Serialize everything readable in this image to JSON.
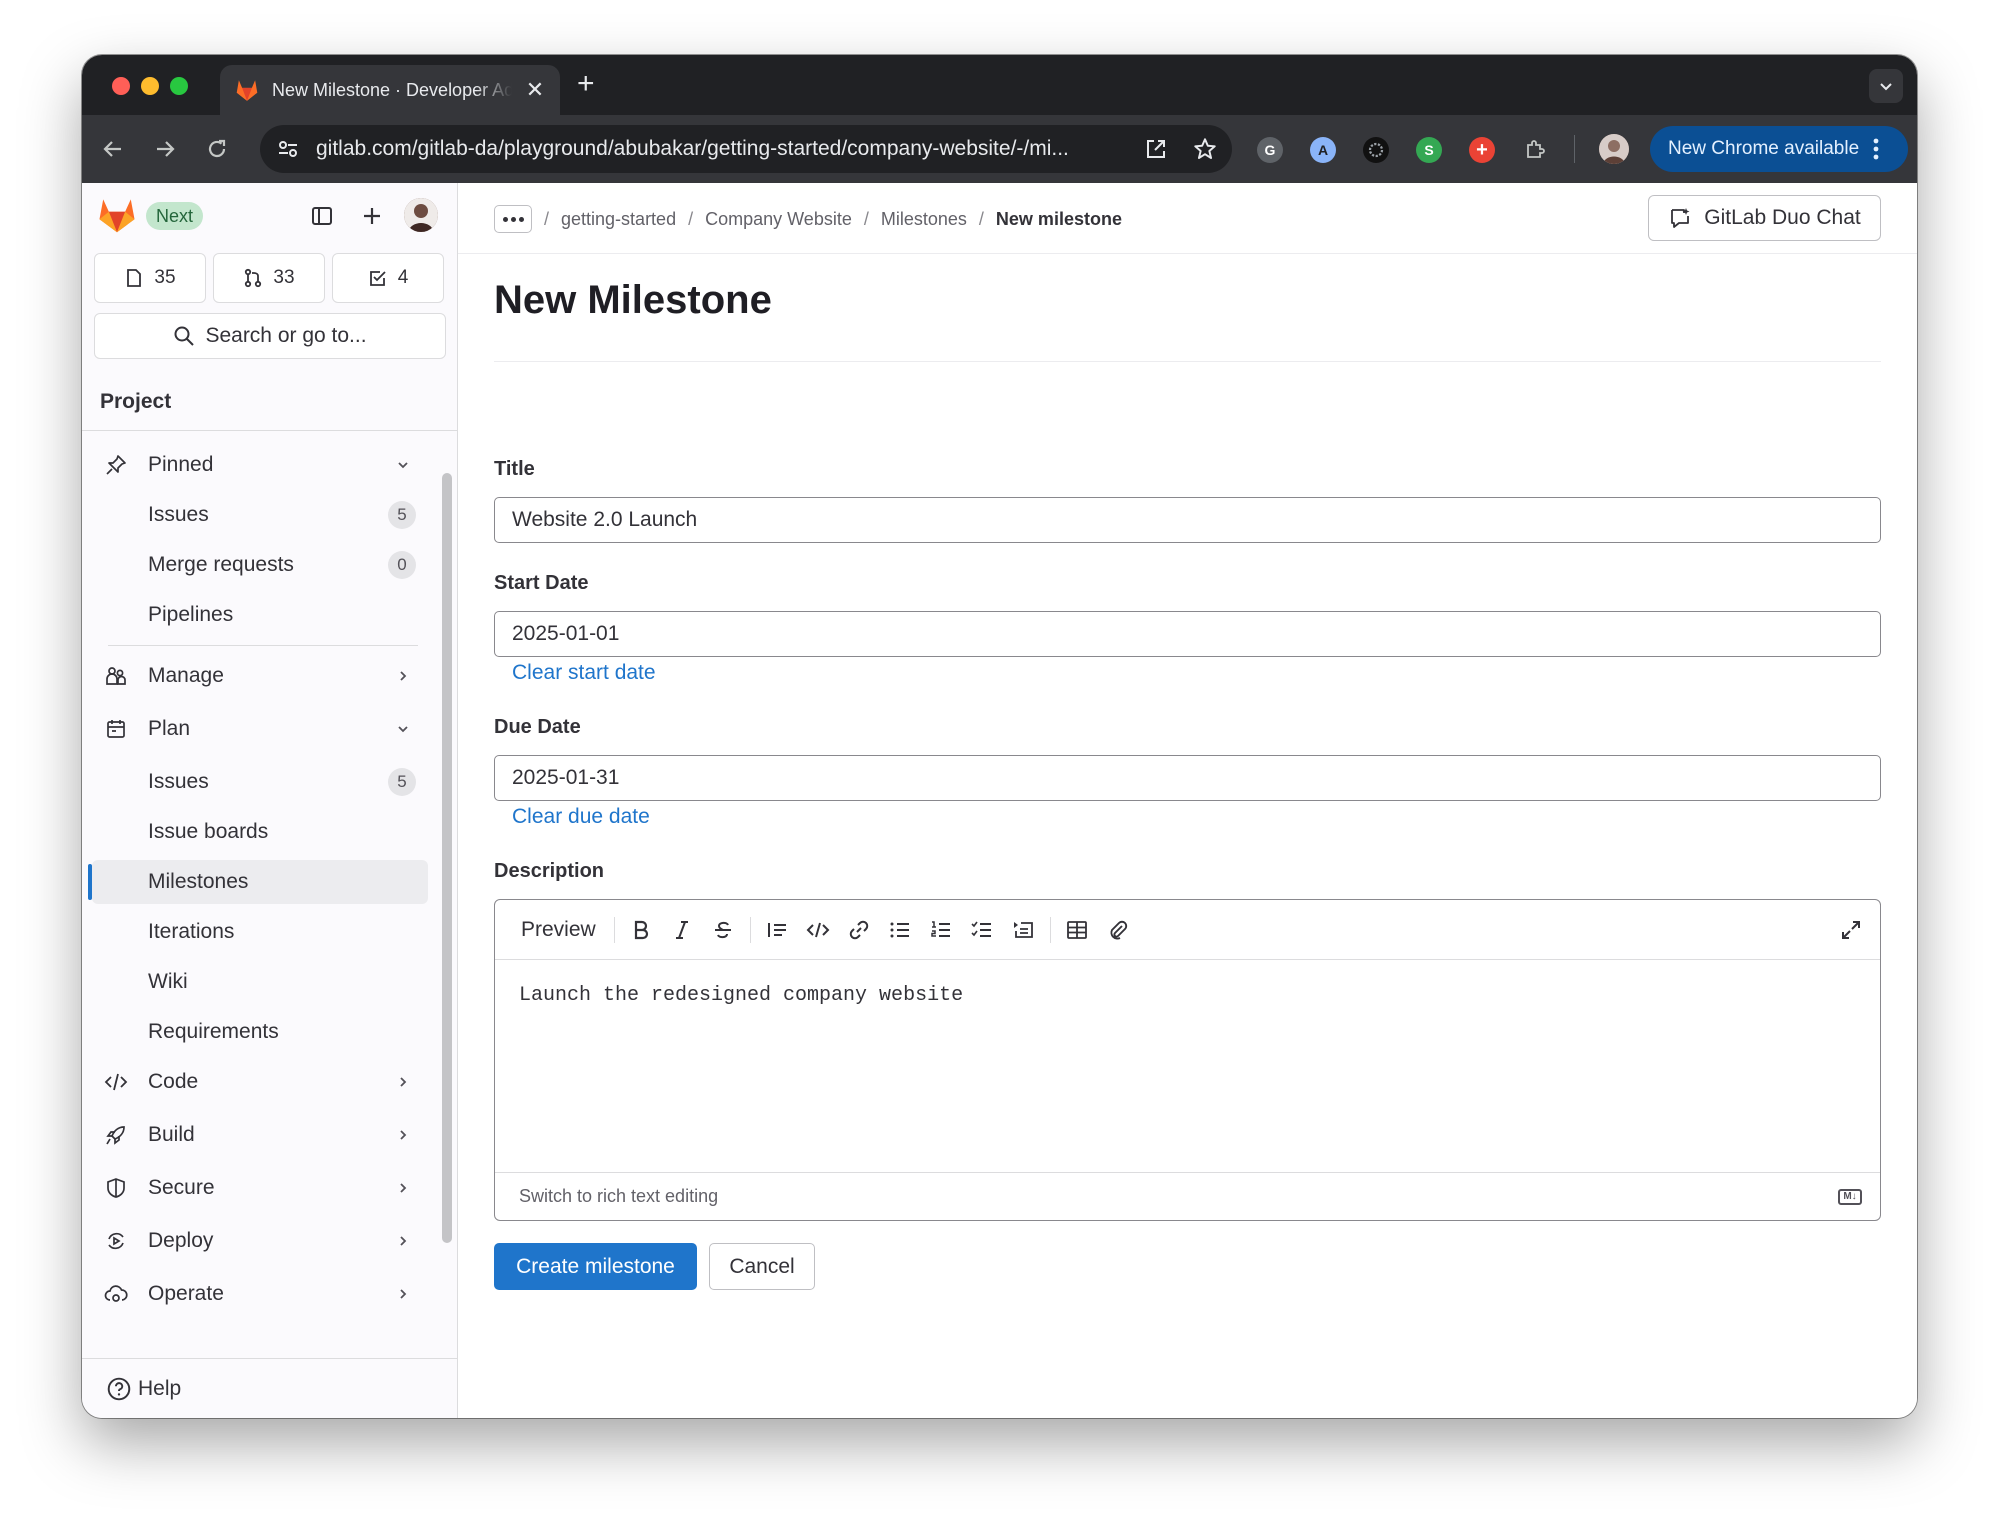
{
  "browser": {
    "tab_title": "New Milestone · Developer Advocacy",
    "url": "gitlab.com/gitlab-da/playground/abubakar/getting-started/company-website/-/mi...",
    "update_label": "New Chrome available"
  },
  "sidebar": {
    "next_badge": "Next",
    "counters": {
      "issues": "35",
      "merge_requests": "33",
      "todos": "4"
    },
    "search_label": "Search or go to...",
    "section_title": "Project",
    "pinned": {
      "label": "Pinned",
      "items": [
        {
          "label": "Issues",
          "count": "5"
        },
        {
          "label": "Merge requests",
          "count": "0"
        },
        {
          "label": "Pipelines"
        }
      ]
    },
    "manage_label": "Manage",
    "plan": {
      "label": "Plan",
      "items": [
        {
          "label": "Issues",
          "count": "5"
        },
        {
          "label": "Issue boards"
        },
        {
          "label": "Milestones"
        },
        {
          "label": "Iterations"
        },
        {
          "label": "Wiki"
        },
        {
          "label": "Requirements"
        }
      ]
    },
    "sections": [
      "Code",
      "Build",
      "Secure",
      "Deploy",
      "Operate"
    ],
    "help_label": "Help"
  },
  "breadcrumbs": [
    "getting-started",
    "Company Website",
    "Milestones",
    "New milestone"
  ],
  "duo_chat_label": "GitLab Duo Chat",
  "page_title": "New Milestone",
  "form": {
    "title_label": "Title",
    "title_value": "Website 2.0 Launch",
    "start_label": "Start Date",
    "start_value": "2025-01-01",
    "clear_start": "Clear start date",
    "due_label": "Due Date",
    "due_value": "2025-01-31",
    "clear_due": "Clear due date",
    "description_label": "Description",
    "preview_label": "Preview",
    "description_value": "Launch the redesigned company website",
    "rich_text_toggle": "Switch to rich text editing",
    "markdown_badge": "M↓",
    "create_label": "Create milestone",
    "cancel_label": "Cancel"
  },
  "colors": {
    "primary": "#1f75cb",
    "next_badge_bg": "#c3e6cd",
    "gitlab_orange": "#fc6d26"
  }
}
